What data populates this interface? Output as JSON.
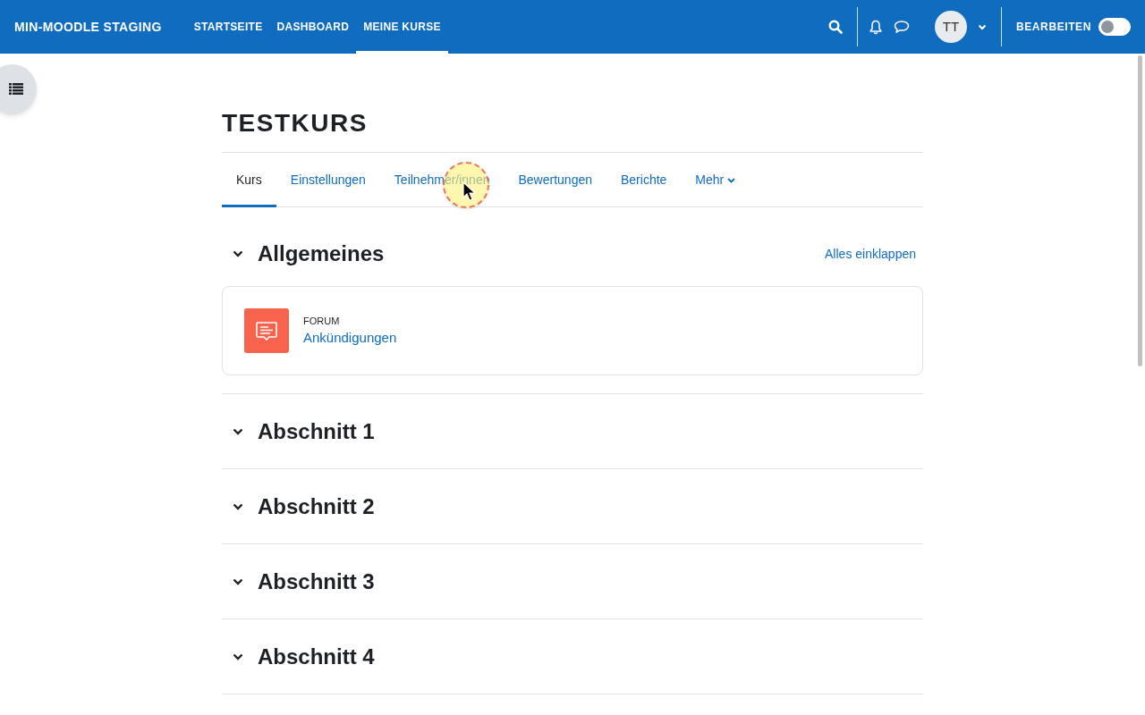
{
  "navbar": {
    "brand": "MIN-MOODLE STAGING",
    "links": [
      {
        "label": "STARTSEITE",
        "selected": false
      },
      {
        "label": "DASHBOARD",
        "selected": false
      },
      {
        "label": "MEINE KURSE",
        "selected": true
      }
    ],
    "avatar": "TT",
    "edit_mode": {
      "label": "BEARBEITEN",
      "on": false
    }
  },
  "course": {
    "title": "TESTKURS",
    "tabs": [
      {
        "label": "Kurs",
        "selected": true,
        "dropdown": false
      },
      {
        "label": "Einstellungen",
        "selected": false,
        "dropdown": false
      },
      {
        "label": "Teilnehmer/innen",
        "selected": false,
        "dropdown": false
      },
      {
        "label": "Bewertungen",
        "selected": false,
        "dropdown": false
      },
      {
        "label": "Berichte",
        "selected": false,
        "dropdown": false
      },
      {
        "label": "Mehr",
        "selected": false,
        "dropdown": true
      }
    ],
    "collapse_all": "Alles einklappen",
    "sections": [
      {
        "title": "Allgemeines",
        "expanded": true,
        "activities": [
          {
            "type": "FORUM",
            "name": "Ankündigungen"
          }
        ]
      },
      {
        "title": "Abschnitt 1",
        "expanded": true
      },
      {
        "title": "Abschnitt 2",
        "expanded": true
      },
      {
        "title": "Abschnitt 3",
        "expanded": true
      },
      {
        "title": "Abschnitt 4",
        "expanded": true
      }
    ]
  }
}
